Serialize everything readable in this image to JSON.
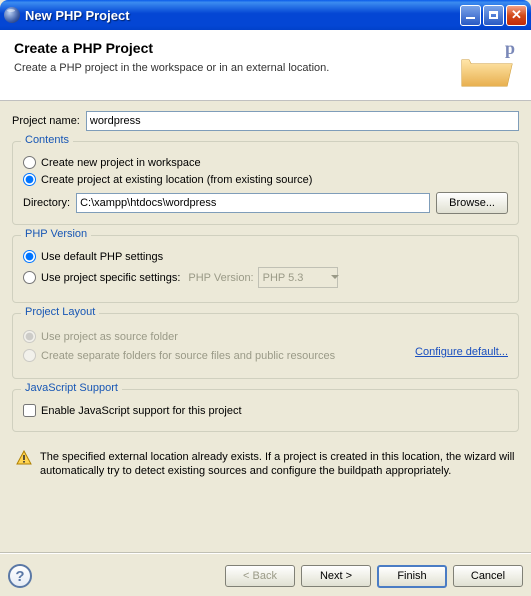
{
  "window": {
    "title": "New PHP Project"
  },
  "header": {
    "title": "Create a PHP Project",
    "description": "Create a PHP project in the workspace or in an external location."
  },
  "project_name": {
    "label": "Project name:",
    "value": "wordpress"
  },
  "contents": {
    "title": "Contents",
    "opt_workspace": "Create new project in workspace",
    "opt_existing": "Create project at existing location (from existing source)",
    "directory_label": "Directory:",
    "directory_value": "C:\\xampp\\htdocs\\wordpress",
    "browse": "Browse..."
  },
  "php_version": {
    "title": "PHP Version",
    "opt_default": "Use default PHP settings",
    "opt_specific": "Use project specific settings:",
    "version_label": "PHP Version:",
    "version_value": "PHP 5.3"
  },
  "project_layout": {
    "title": "Project Layout",
    "opt_source": "Use project as source folder",
    "opt_separate": "Create separate folders for source files and public resources",
    "configure_link": "Configure default..."
  },
  "js_support": {
    "title": "JavaScript Support",
    "checkbox_label": "Enable JavaScript support for this project"
  },
  "info": {
    "text": "The specified external location already exists. If a project is created in this location, the wizard will automatically try to detect existing sources and configure the buildpath appropriately."
  },
  "buttons": {
    "back": "< Back",
    "next": "Next >",
    "finish": "Finish",
    "cancel": "Cancel"
  }
}
